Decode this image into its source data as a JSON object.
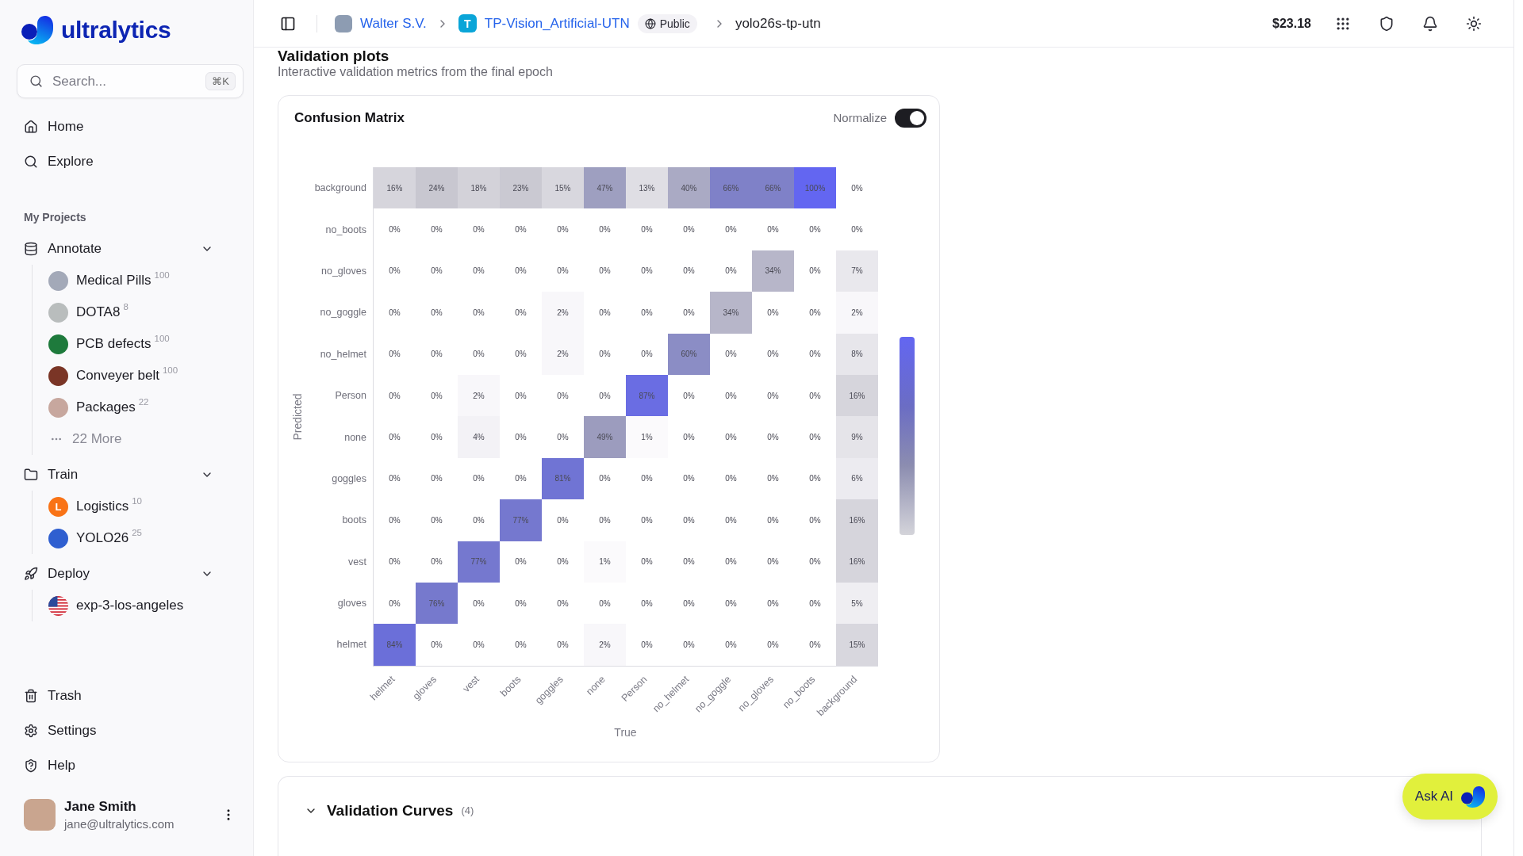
{
  "sidebar": {
    "brand": "ultralytics",
    "search": {
      "placeholder": "Search...",
      "shortcut": "⌘K"
    },
    "nav": [
      {
        "label": "Home"
      },
      {
        "label": "Explore"
      }
    ],
    "section_label": "My Projects",
    "groups": [
      {
        "label": "Annotate",
        "expanded": true,
        "children": [
          {
            "kind": "photo",
            "label": "Medical Pills",
            "count": "100",
            "color": "#a3a9b8"
          },
          {
            "kind": "photo",
            "label": "DOTA8",
            "count": "8",
            "color": "#b9bdbd"
          },
          {
            "kind": "photo",
            "label": "PCB defects",
            "count": "100",
            "color": "#1e7a3c"
          },
          {
            "kind": "photo",
            "label": "Conveyer belt",
            "count": "100",
            "color": "#7a3526"
          },
          {
            "kind": "photo",
            "label": "Packages",
            "count": "22",
            "color": "#c7a79e"
          }
        ],
        "more": "22 More"
      },
      {
        "label": "Train",
        "expanded": true,
        "children": [
          {
            "kind": "letter",
            "initial": "L",
            "label": "Logistics",
            "count": "10",
            "color": "#f97316"
          },
          {
            "kind": "photo",
            "label": "YOLO26",
            "count": "25",
            "color": "#2f5fd0"
          }
        ]
      },
      {
        "label": "Deploy",
        "expanded": true,
        "children": [
          {
            "kind": "flag",
            "label": "exp-3-los-angeles"
          }
        ]
      }
    ],
    "footer_nav": [
      {
        "label": "Trash"
      },
      {
        "label": "Settings"
      },
      {
        "label": "Help"
      }
    ],
    "user": {
      "name": "Jane Smith",
      "email": "jane@ultralytics.com"
    }
  },
  "topbar": {
    "breadcrumb": [
      {
        "kind": "owner",
        "label": "Walter S.V."
      },
      {
        "kind": "project",
        "initial": "T",
        "label": "TP-Vision_Artificial-UTN",
        "visibility": "Public"
      },
      {
        "kind": "current",
        "label": "yolo26s-tp-utn"
      }
    ],
    "balance": "$23.18"
  },
  "page": {
    "title": "Validation plots",
    "subtitle": "Interactive validation metrics from the final epoch"
  },
  "confusion_matrix": {
    "title": "Confusion Matrix",
    "normalize": {
      "label": "Normalize",
      "on": true
    },
    "y_label": "Predicted",
    "rows": [
      {
        "label": "background",
        "cells": [
          {
            "text": "16%",
            "color": "#d6d5dc"
          },
          {
            "text": "24%",
            "color": "#c8c7d0"
          },
          {
            "text": "18%",
            "color": "#d3d2d9"
          },
          {
            "text": "23%",
            "color": "#cac9d2"
          },
          {
            "text": "15%",
            "color": "#d8d7de"
          },
          {
            "text": "47%",
            "color": "#9e9fc0"
          },
          {
            "text": "13%",
            "color": "#dfdee4"
          },
          {
            "text": "40%",
            "color": "#aaaac4"
          },
          {
            "text": "66%",
            "color": "#7f81c8"
          },
          {
            "text": "66%",
            "color": "#7f81c8"
          },
          {
            "text": "100%",
            "color": "#6366f1"
          },
          {
            "text": "0%"
          }
        ]
      },
      {
        "label": "no_boots",
        "cells": [
          {
            "text": "0%"
          },
          {
            "text": "0%"
          },
          {
            "text": "0%"
          },
          {
            "text": "0%"
          },
          {
            "text": "0%"
          },
          {
            "text": "0%"
          },
          {
            "text": "0%"
          },
          {
            "text": "0%"
          },
          {
            "text": "0%"
          },
          {
            "text": "0%"
          },
          {
            "text": "0%"
          },
          {
            "text": "0%"
          }
        ]
      },
      {
        "label": "no_gloves",
        "cells": [
          {
            "text": "0%"
          },
          {
            "text": "0%"
          },
          {
            "text": "0%"
          },
          {
            "text": "0%"
          },
          {
            "text": "0%"
          },
          {
            "text": "0%"
          },
          {
            "text": "0%"
          },
          {
            "text": "0%"
          },
          {
            "text": "0%"
          },
          {
            "text": "34%",
            "color": "#b7b6c9"
          },
          {
            "text": "0%"
          },
          {
            "text": "7%",
            "color": "#e9e8ed"
          }
        ]
      },
      {
        "label": "no_goggle",
        "cells": [
          {
            "text": "0%"
          },
          {
            "text": "0%"
          },
          {
            "text": "0%"
          },
          {
            "text": "0%"
          },
          {
            "text": "2%",
            "color": "#f8f7fa"
          },
          {
            "text": "0%"
          },
          {
            "text": "0%"
          },
          {
            "text": "0%"
          },
          {
            "text": "34%",
            "color": "#b7b6c9"
          },
          {
            "text": "0%"
          },
          {
            "text": "0%"
          },
          {
            "text": "2%",
            "color": "#f8f7fa"
          }
        ]
      },
      {
        "label": "no_helmet",
        "cells": [
          {
            "text": "0%"
          },
          {
            "text": "0%"
          },
          {
            "text": "0%"
          },
          {
            "text": "0%"
          },
          {
            "text": "2%",
            "color": "#f8f7fa"
          },
          {
            "text": "0%"
          },
          {
            "text": "0%"
          },
          {
            "text": "60%",
            "color": "#8b8dc5"
          },
          {
            "text": "0%"
          },
          {
            "text": "0%"
          },
          {
            "text": "0%"
          },
          {
            "text": "8%",
            "color": "#e7e6eb"
          }
        ]
      },
      {
        "label": "Person",
        "cells": [
          {
            "text": "0%"
          },
          {
            "text": "0%"
          },
          {
            "text": "2%",
            "color": "#f8f7fa"
          },
          {
            "text": "0%"
          },
          {
            "text": "0%"
          },
          {
            "text": "0%"
          },
          {
            "text": "87%",
            "color": "#6a6de3"
          },
          {
            "text": "0%"
          },
          {
            "text": "0%"
          },
          {
            "text": "0%"
          },
          {
            "text": "0%"
          },
          {
            "text": "16%",
            "color": "#d6d5dc"
          }
        ]
      },
      {
        "label": "none",
        "cells": [
          {
            "text": "0%"
          },
          {
            "text": "0%"
          },
          {
            "text": "4%",
            "color": "#f3f2f6"
          },
          {
            "text": "0%"
          },
          {
            "text": "0%"
          },
          {
            "text": "49%",
            "color": "#9c9cbe"
          },
          {
            "text": "1%",
            "color": "#fbfafc"
          },
          {
            "text": "0%"
          },
          {
            "text": "0%"
          },
          {
            "text": "0%"
          },
          {
            "text": "0%"
          },
          {
            "text": "9%",
            "color": "#e5e4e9"
          }
        ]
      },
      {
        "label": "goggles",
        "cells": [
          {
            "text": "0%"
          },
          {
            "text": "0%"
          },
          {
            "text": "0%"
          },
          {
            "text": "0%"
          },
          {
            "text": "81%",
            "color": "#7074d4"
          },
          {
            "text": "0%"
          },
          {
            "text": "0%"
          },
          {
            "text": "0%"
          },
          {
            "text": "0%"
          },
          {
            "text": "0%"
          },
          {
            "text": "0%"
          },
          {
            "text": "6%",
            "color": "#ecebf0"
          }
        ]
      },
      {
        "label": "boots",
        "cells": [
          {
            "text": "0%"
          },
          {
            "text": "0%"
          },
          {
            "text": "0%"
          },
          {
            "text": "77%",
            "color": "#7578cf"
          },
          {
            "text": "0%"
          },
          {
            "text": "0%"
          },
          {
            "text": "0%"
          },
          {
            "text": "0%"
          },
          {
            "text": "0%"
          },
          {
            "text": "0%"
          },
          {
            "text": "0%"
          },
          {
            "text": "16%",
            "color": "#d6d5dc"
          }
        ]
      },
      {
        "label": "vest",
        "cells": [
          {
            "text": "0%"
          },
          {
            "text": "0%"
          },
          {
            "text": "77%",
            "color": "#7578cf"
          },
          {
            "text": "0%"
          },
          {
            "text": "0%"
          },
          {
            "text": "1%",
            "color": "#fbfafc"
          },
          {
            "text": "0%"
          },
          {
            "text": "0%"
          },
          {
            "text": "0%"
          },
          {
            "text": "0%"
          },
          {
            "text": "0%"
          },
          {
            "text": "16%",
            "color": "#d6d5dc"
          }
        ]
      },
      {
        "label": "gloves",
        "cells": [
          {
            "text": "0%"
          },
          {
            "text": "76%",
            "color": "#7679cd"
          },
          {
            "text": "0%"
          },
          {
            "text": "0%"
          },
          {
            "text": "0%"
          },
          {
            "text": "0%"
          },
          {
            "text": "0%"
          },
          {
            "text": "0%"
          },
          {
            "text": "0%"
          },
          {
            "text": "0%"
          },
          {
            "text": "0%"
          },
          {
            "text": "5%",
            "color": "#efeef2"
          }
        ]
      },
      {
        "label": "helmet",
        "cells": [
          {
            "text": "84%",
            "color": "#6b6fd9"
          },
          {
            "text": "0%"
          },
          {
            "text": "0%"
          },
          {
            "text": "0%"
          },
          {
            "text": "0%"
          },
          {
            "text": "2%",
            "color": "#f8f7fa"
          },
          {
            "text": "0%"
          },
          {
            "text": "0%"
          },
          {
            "text": "0%"
          },
          {
            "text": "0%"
          },
          {
            "text": "0%"
          },
          {
            "text": "15%",
            "color": "#d8d7de"
          }
        ]
      }
    ],
    "x_axis_labels": [
      "helmet",
      "gloves",
      "vest",
      "boots",
      "goggles",
      "none",
      "Person",
      "no_helmet",
      "no_goggle",
      "no_gloves",
      "no_boots",
      "background"
    ],
    "x_label": "True"
  },
  "validation_curves": {
    "title": "Validation Curves",
    "count": "(4)",
    "expanded": true
  },
  "ask_ai": {
    "label": "Ask AI"
  }
}
